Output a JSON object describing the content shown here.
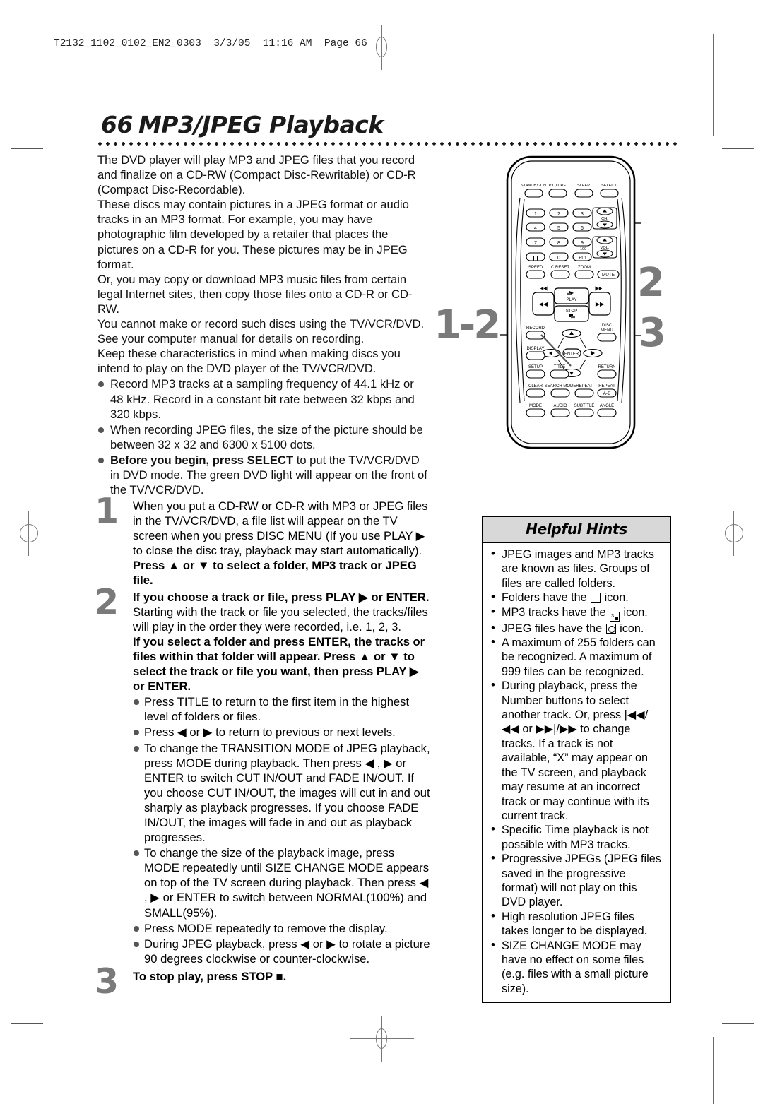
{
  "print_slug": "T2132_1102_0102_EN2_0303  3/3/05  11:16 AM  Page 66",
  "title": {
    "number": "66",
    "text": "MP3/JPEG Playback"
  },
  "intro_paragraphs": [
    "The DVD player will play MP3 and JPEG files that you record and finalize on a CD-RW (Compact Disc-Rewritable) or CD-R (Compact Disc-Recordable).",
    "These discs may contain pictures in a JPEG format or audio tracks in an MP3 format.  For example, you may have photographic film developed by a retailer that places the pictures on a CD-R for you.  These pictures may be in JPEG format.",
    "Or, you may copy or download MP3 music files from certain legal Internet sites, then copy those files onto a CD-R or CD-RW.",
    "You cannot make or record such discs using the TV/VCR/DVD.  See your computer manual for details on recording.",
    "Keep these characteristics in mind when making discs you intend to play on the DVD player of the TV/VCR/DVD."
  ],
  "intro_bullets": [
    {
      "bold_prefix": "",
      "text": "Record MP3 tracks at a sampling frequency of 44.1 kHz or 48 kHz. Record in a constant bit rate between 32 kbps and 320 kbps."
    },
    {
      "bold_prefix": "",
      "text": "When recording JPEG files, the size of the picture should be between 32 x 32 and 6300 x 5100 dots."
    },
    {
      "bold_prefix": "Before you begin, press SELECT",
      "text": " to put the TV/VCR/DVD in DVD mode.  The green DVD light will appear on the front of the TV/VCR/DVD."
    }
  ],
  "steps": [
    {
      "number": "1",
      "normal": "When you put a CD-RW or CD-R with MP3 or JPEG files in the TV/VCR/DVD, a file list will appear on the TV screen when you press DISC MENU (If you use PLAY ▶ to close the disc tray, playback may start automatically). ",
      "bold": "Press ▲ or ▼ to select a folder, MP3 track or JPEG file."
    },
    {
      "number": "2",
      "bold_lead": "If you choose a track or file, press PLAY ▶ or ENTER.",
      "normal": " Starting with the track or file you selected, the tracks/files will play in the order they were recorded, i.e. 1, 2, 3.",
      "bold_block": "If you select a folder and press ENTER, the tracks or files within that folder will appear. Press ▲ or ▼ to select the track or file you want, then press PLAY ▶ or ENTER.",
      "bullets": [
        "Press TITLE to return to the first item in the highest level of folders or files.",
        "Press ◀ or ▶ to return to previous or next levels.",
        "To change the TRANSITION MODE of JPEG playback, press MODE during playback.  Then press ◀ , ▶ or ENTER to switch CUT IN/OUT and FADE IN/OUT.  If you choose CUT IN/OUT, the images will cut in and out sharply as playback progresses.  If you choose FADE IN/OUT, the images will fade in and out as playback progresses.",
        "To change the size of the playback image, press MODE repeatedly until SIZE CHANGE MODE appears on top of the TV screen during playback.  Then press ◀ , ▶ or ENTER to switch between NORMAL(100%) and SMALL(95%).",
        "Press MODE repeatedly to remove the display.",
        "During JPEG playback, press ◀ or ▶ to rotate a picture 90 degrees clockwise or counter-clockwise."
      ]
    },
    {
      "number": "3",
      "bold": "To stop play, press STOP ■."
    }
  ],
  "callouts": [
    {
      "label": "1-2"
    },
    {
      "label": "2"
    },
    {
      "label": "3"
    }
  ],
  "remote": {
    "row_top": [
      "STANDBY·ON",
      "PICTURE",
      "SLEEP",
      "SELECT"
    ],
    "numbers": [
      "1",
      "2",
      "3",
      "4",
      "5",
      "6",
      "7",
      "8",
      "9"
    ],
    "pause": "❙❙",
    "zero": "0",
    "plus10": "+10",
    "plus100": "+100",
    "ch_label": "CH.",
    "vol_label": "VOL.",
    "row_speed": [
      "SPEED",
      "C.RESET",
      "ZOOM"
    ],
    "mute": "MUTE",
    "play": "PLAY",
    "stop": "STOP",
    "skip_prev": "◀◀|",
    "skip_next": "|▶▶",
    "rew": "◀◀",
    "ff": "▶▶",
    "record": "RECORD",
    "disc_menu_l1": "DISC",
    "disc_menu_l2": "MENU",
    "display": "DISPLAY",
    "enter": "ENTER",
    "setup": "SETUP",
    "title": "TITLE",
    "return": "RETURN",
    "clear": "CLEAR",
    "search_mode": "SEARCH MODE",
    "repeat": "REPEAT",
    "repeat_ab_label": "REPEAT",
    "repeat_ab": "A-B",
    "mode": "MODE",
    "audio": "AUDIO",
    "subtitle": "SUBTITLE",
    "angle": "ANGLE"
  },
  "hints": {
    "title": "Helpful Hints",
    "items": [
      {
        "pre": "JPEG images and MP3 tracks are known as files. Groups of files are called folders.",
        "icon": null,
        "post": ""
      },
      {
        "pre": "Folders have the ",
        "icon": "folder-icon",
        "post": " icon."
      },
      {
        "pre": "MP3 tracks have the ",
        "icon": "mp3-icon",
        "post": " icon."
      },
      {
        "pre": "JPEG files have the ",
        "icon": "jpeg-icon",
        "post": " icon."
      },
      {
        "pre": "A maximum of 255 folders can be recognized. A maximum of 999 files can be recognized.",
        "icon": null,
        "post": ""
      },
      {
        "pre": "During playback, press the Number buttons to select another track. Or, press |◀◀/◀◀ or ▶▶|/▶▶ to change tracks. If a track is not available, “X” may appear on the TV screen, and playback may resume at an incorrect track or may continue with its current track.",
        "icon": null,
        "post": ""
      },
      {
        "pre": "Specific Time playback is not possible with MP3 tracks.",
        "icon": null,
        "post": ""
      },
      {
        "pre": "Progressive JPEGs (JPEG files saved in the progressive format) will not play on this DVD player.",
        "icon": null,
        "post": ""
      },
      {
        "pre": "High resolution JPEG files takes longer to be displayed.",
        "icon": null,
        "post": ""
      },
      {
        "pre": "SIZE CHANGE MODE may have no effect on some files (e.g. files with a small picture size).",
        "icon": null,
        "post": ""
      }
    ]
  },
  "colors": {
    "step_number": "#7a7a7a",
    "hint_header_bg": "#d8d8d8",
    "text": "#111111"
  }
}
